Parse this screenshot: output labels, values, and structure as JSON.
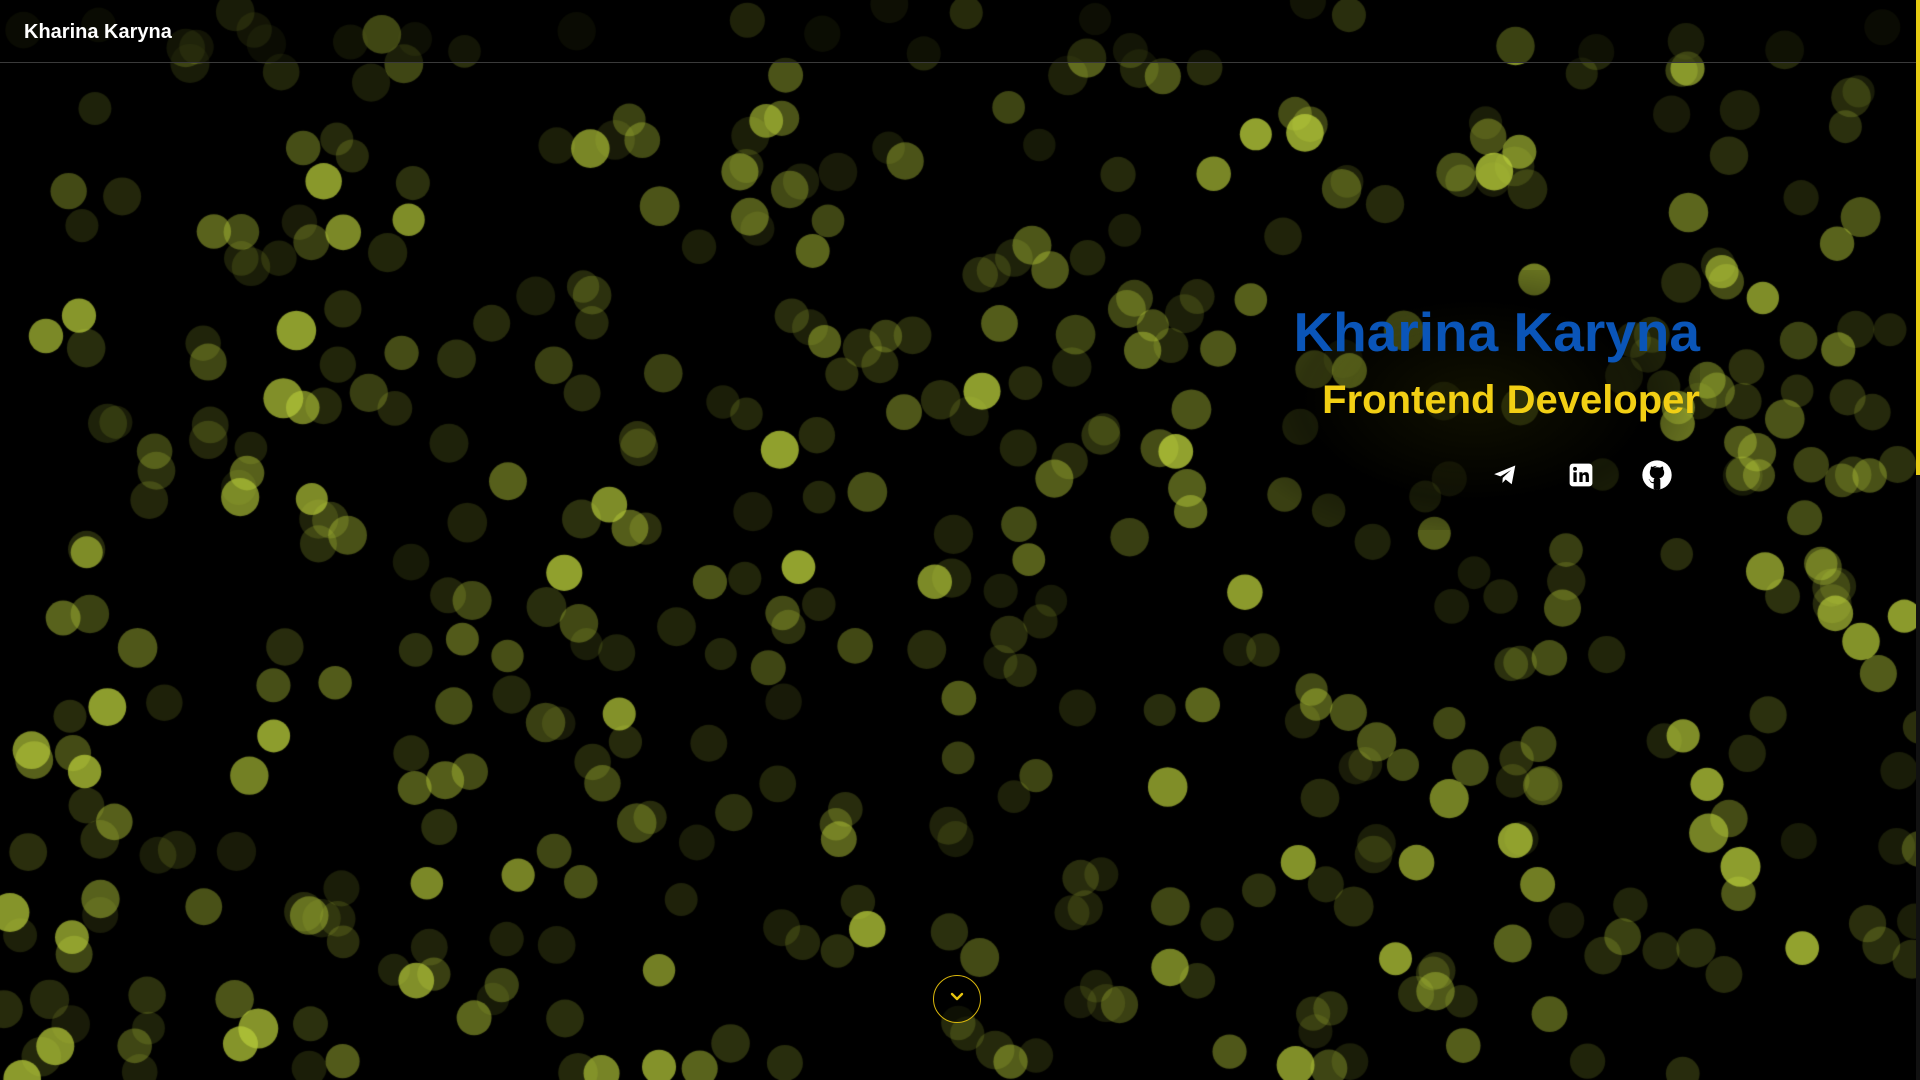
{
  "header": {
    "brand": "Kharina Karyna"
  },
  "hero": {
    "name": "Kharina Karyna",
    "role": "Frontend Developer"
  },
  "socials": [
    {
      "icon": "telegram-icon"
    },
    {
      "icon": "linkedin-icon"
    },
    {
      "icon": "github-icon"
    }
  ],
  "scroll_button": {
    "icon": "chevron-down-icon"
  },
  "scrollbar": {
    "position_fraction": 0.0,
    "visible_fraction": 0.44
  },
  "colors": {
    "background": "#000000",
    "name": "#0a55b8",
    "role": "#f2cf14",
    "accent": "#d9b70c",
    "bokeh": "#b8cc3a"
  }
}
